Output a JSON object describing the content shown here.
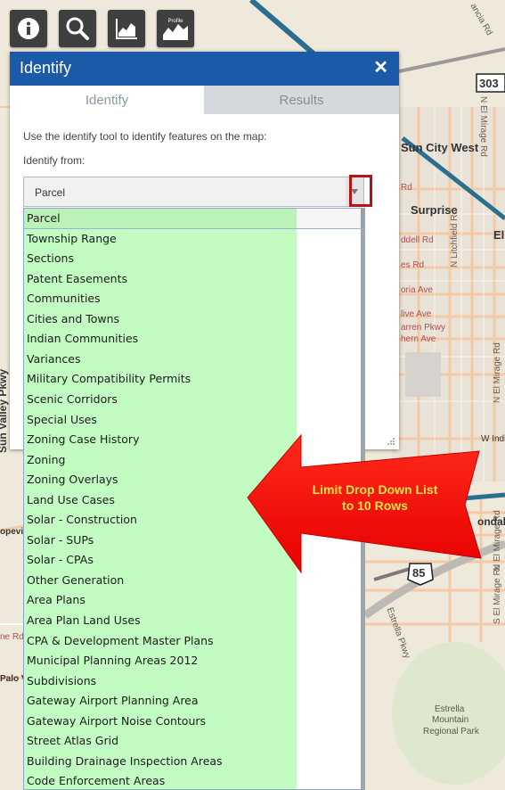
{
  "toolbar": {
    "buttons": [
      {
        "name": "info-tool-button",
        "icon": "info-icon"
      },
      {
        "name": "search-tool-button",
        "icon": "magnifier-icon"
      },
      {
        "name": "chart-tool-button",
        "icon": "area-chart-icon"
      },
      {
        "name": "profile-tool-button",
        "icon": "elevation-profile-icon",
        "label": "Profile"
      }
    ]
  },
  "panel": {
    "title": "Identify",
    "close_symbol": "✕",
    "tabs": [
      {
        "label": "Identify",
        "active": true
      },
      {
        "label": "Results",
        "active": false
      }
    ],
    "intro_text": "Use the identify tool to identify features on the map:",
    "identify_from_label": "Identify from:",
    "select_value": "Parcel"
  },
  "dropdown": {
    "items": [
      "Parcel",
      "Township Range",
      "Sections",
      "Patent Easements",
      "Communities",
      "Cities and Towns",
      "Indian Communities",
      "Variances",
      "Military Compatibility Permits",
      "Scenic Corridors",
      "Special Uses",
      "Zoning Case History",
      "Zoning",
      "Zoning Overlays",
      "Land Use Cases",
      "Solar - Construction",
      "Solar - SUPs",
      "Solar - CPAs",
      "Other Generation",
      "Area Plans",
      "Area Plan Land Uses",
      "CPA & Development Master Plans",
      "Municipal Planning Areas 2012",
      "Subdivisions",
      "Gateway Airport Planning Area",
      "Gateway Airport Noise Contours",
      "Street Atlas Grid",
      "Building Drainage Inspection Areas",
      "Code Enforcement Areas"
    ]
  },
  "annotation": {
    "text_line1": "Limit Drop Down List",
    "text_line2": "to 10 Rows",
    "arrow_color": "#ff0000",
    "text_color": "#ffe24a",
    "highlight_color": "#b31616"
  },
  "map": {
    "labels": {
      "city_west": "Sun City West",
      "surprise": "Surprise",
      "el_cut": "El",
      "route_303": "303",
      "route_85": "85",
      "estrella_park_1": "Estrella",
      "estrella_park_2": "Mountain",
      "estrella_park_3": "Regional Park",
      "sun_valley_pkwy": "Sun Valley Pkwy",
      "cancia_road": "ancia Rd",
      "n_el_mirage_rd_top": "N El Mirage Rd",
      "n_litchfield_rd": "N Litchfield Rd",
      "n_el_mirage_rd_mid": "N El Mirage Rd",
      "n_el_mirage_rd_low": "N El Mirage Rd",
      "s_el_mirage_rd": "S El Mirage Rd",
      "w_indi": "W Indi",
      "ondale": "ondale",
      "estrella_pkwy": "Estrella Pkwy",
      "r_rd": "Rd",
      "ddell_rd": "ddell Rd",
      "es_rd": "es Rd",
      "oria_ave": "oria Ave",
      "live_ave": "live Ave",
      "arren_pkwy": "arren Pkwy",
      "hern_ave": "hern Ave",
      "opevi": "opevi",
      "ne_rd": "ne Rd",
      "palo_v": "Palo V"
    }
  }
}
